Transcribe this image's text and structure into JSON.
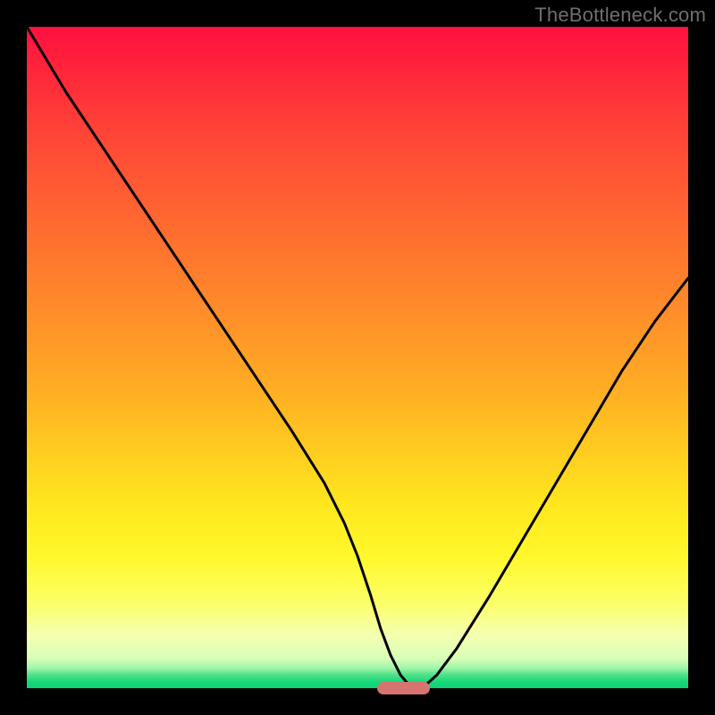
{
  "attribution": "TheBottleneck.com",
  "colors": {
    "frame": "#000000",
    "curve": "#000000",
    "marker": "#d7746f"
  },
  "chart_data": {
    "type": "line",
    "title": "",
    "xlabel": "",
    "ylabel": "",
    "xlim": [
      0,
      100
    ],
    "ylim": [
      0,
      100
    ],
    "grid": false,
    "legend": false,
    "series": [
      {
        "name": "bottleneck-curve",
        "x": [
          0,
          3,
          6,
          9,
          12,
          15,
          20,
          25,
          30,
          35,
          40,
          45,
          48,
          50,
          52,
          53.5,
          55,
          56.5,
          58,
          60,
          62,
          65,
          70,
          75,
          80,
          85,
          90,
          95,
          100
        ],
        "y": [
          100,
          95,
          90,
          85.5,
          81,
          76.5,
          69,
          61.5,
          54,
          46.5,
          39,
          31,
          25,
          20,
          14,
          9,
          5,
          2,
          0.2,
          0.2,
          2,
          6,
          14,
          22.5,
          31,
          39.5,
          48,
          55.5,
          62
        ]
      }
    ],
    "marker": {
      "x_start": 53,
      "x_end": 61,
      "y": 0
    }
  }
}
